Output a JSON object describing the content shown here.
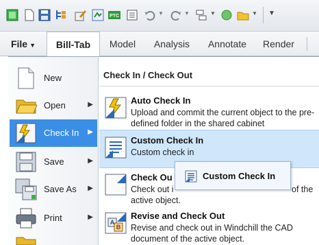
{
  "toolbar": {
    "icons": [
      "app-icon",
      "new-icon",
      "save-icon",
      "model-tree-icon",
      "sketch-icon",
      "regenerate-icon",
      "ptc-icon",
      "window-icon",
      "undo-icon",
      "redo-icon",
      "layers-icon",
      "appearance-icon",
      "open-folder-icon",
      "overflow-icon"
    ]
  },
  "tabs": [
    {
      "label": "File"
    },
    {
      "label": "Bill-Tab"
    },
    {
      "label": "Model"
    },
    {
      "label": "Analysis"
    },
    {
      "label": "Annotate"
    },
    {
      "label": "Render"
    }
  ],
  "left_menu": {
    "items": [
      {
        "label": "New",
        "icon": "document-icon"
      },
      {
        "label": "Open",
        "icon": "folder-icon"
      },
      {
        "label": "Check In",
        "icon": "check-in-icon"
      },
      {
        "label": "Save",
        "icon": "save-icon"
      },
      {
        "label": "Save As",
        "icon": "save-as-icon"
      },
      {
        "label": "Print",
        "icon": "printer-icon"
      }
    ]
  },
  "submenu": {
    "header": "Check In / Check Out",
    "items": [
      {
        "title": "Auto Check In",
        "desc": "Upload and commit the current object to the pre-defined folder in the shared cabinet"
      },
      {
        "title": "Custom Check In",
        "desc": "Custom check in"
      },
      {
        "title": "Check Ou",
        "desc_line1": "Check out i",
        "desc_line1_end": "of the",
        "desc_line2": "active object."
      },
      {
        "title": "Revise and Check Out",
        "desc": "Revise and check out in Windchill the CAD document of the active object."
      }
    ]
  },
  "tooltip": {
    "label": "Custom Check In"
  },
  "colors": {
    "selected": "#3a8ee6",
    "highlight": "#cfe6fb",
    "accent_yellow": "#f5c400",
    "accent_blue": "#2a6ab8"
  }
}
